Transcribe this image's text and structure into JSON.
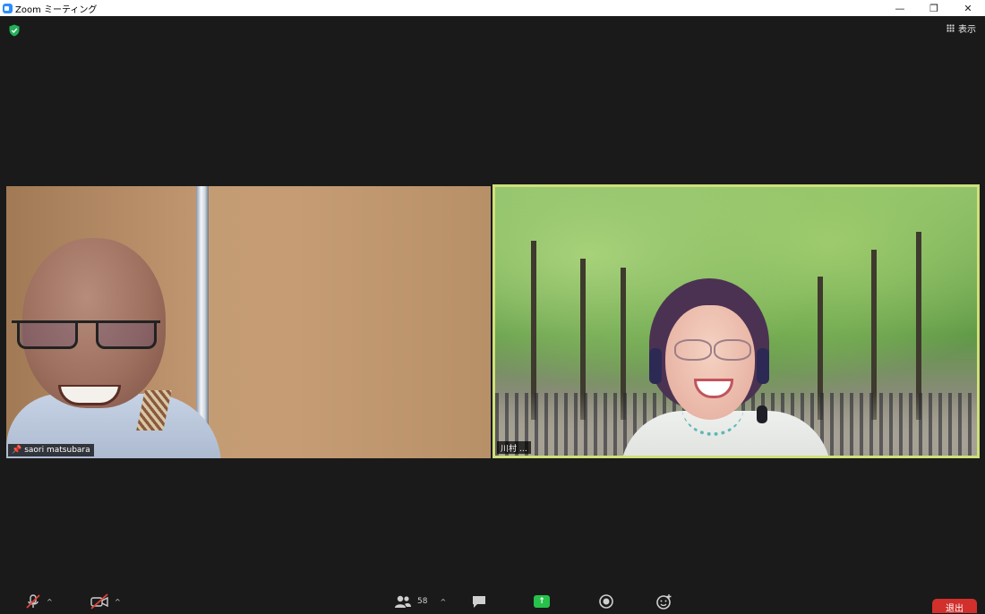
{
  "window": {
    "app_name": "Zoom",
    "title_suffix": "ミーティング",
    "minimize": "—",
    "restore": "❐",
    "close": "✕"
  },
  "header": {
    "view_label": "表示"
  },
  "participants": [
    {
      "name": "saori matsubara",
      "pinned": true
    },
    {
      "name": "川村 …",
      "pinned": false,
      "active_speaker": true
    }
  ],
  "toolbar": {
    "participant_count": "58",
    "leave_label": "退出"
  },
  "colors": {
    "active_speaker_border": "#cfe07a",
    "leave_button": "#d2302c",
    "share_button": "#27c24c",
    "shield": "#23b15a"
  }
}
